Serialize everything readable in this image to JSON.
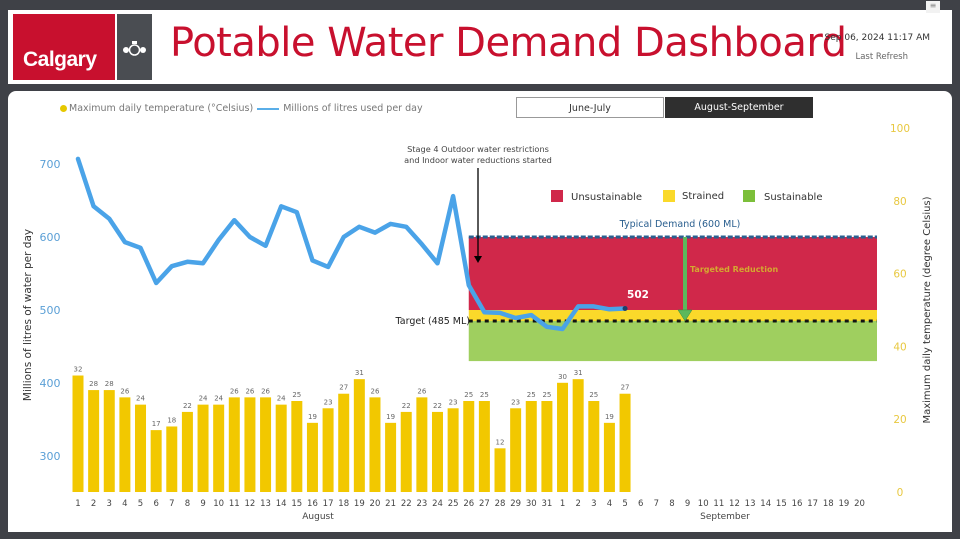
{
  "header": {
    "logo_text": "Calgary",
    "title": "Potable Water Demand Dashboard",
    "refresh_datetime": "Sep 06, 2024 11:17 AM",
    "refresh_label": "Last Refresh",
    "filter_icon": "filter-lines-icon"
  },
  "legend": {
    "temperature_label": "Maximum daily temperature (°Celsius)",
    "usage_label": "Millions of litres used per day"
  },
  "tabs": [
    {
      "label": "June-July",
      "active": false
    },
    {
      "label": "August-September",
      "active": true
    }
  ],
  "colors": {
    "brand_red": "#c8102e",
    "line_blue": "#4aa3e8",
    "bar_yellow": "#f2c800",
    "unsustainable": "#d0284a",
    "strained": "#fad92a",
    "sustainable": "#9fcf5f",
    "typical_demand": "#2a5f8f",
    "arrow_green": "#5cb85c",
    "targeted_text": "#d4a830"
  },
  "chart_data": {
    "type": "bar+line",
    "title": "Potable Water Demand Dashboard",
    "x_groups": [
      {
        "month": "August",
        "days": [
          1,
          2,
          3,
          4,
          5,
          6,
          7,
          8,
          9,
          10,
          11,
          12,
          13,
          14,
          15,
          16,
          17,
          18,
          19,
          20,
          21,
          22,
          23,
          24,
          25,
          26,
          27,
          28,
          29,
          30,
          31
        ]
      },
      {
        "month": "September",
        "days": [
          1,
          2,
          3,
          4,
          5,
          6,
          7,
          8,
          9,
          10,
          11,
          12,
          13,
          14,
          15,
          16,
          17,
          18,
          19,
          20
        ]
      }
    ],
    "ylabel_left": "Millions of litres of water per day",
    "ylabel_right": "Maximum daily temperature (degree Celsius)",
    "y_left_ticks": [
      300,
      400,
      500,
      600,
      700
    ],
    "y_left_range": [
      250,
      750
    ],
    "y_right_ticks": [
      0,
      20,
      40,
      60,
      80,
      100
    ],
    "y_right_range": [
      0,
      100
    ],
    "series": [
      {
        "name": "Millions of litres used per day",
        "type": "line",
        "axis": "left",
        "values": [
          707,
          642,
          625,
          593,
          585,
          537,
          560,
          566,
          564,
          596,
          623,
          600,
          588,
          642,
          634,
          568,
          559,
          600,
          614,
          606,
          618,
          614,
          590,
          564,
          656,
          534,
          497,
          496,
          489,
          493,
          477,
          474,
          505,
          505,
          501,
          502
        ]
      },
      {
        "name": "Maximum daily temperature (°Celsius)",
        "type": "bar",
        "axis": "right",
        "values": [
          32,
          28,
          28,
          26,
          24,
          17,
          18,
          22,
          24,
          24,
          26,
          26,
          26,
          24,
          25,
          19,
          23,
          27,
          31,
          26,
          19,
          22,
          26,
          22,
          23,
          25,
          25,
          12,
          23,
          25,
          25,
          30,
          31,
          25,
          19,
          27
        ]
      }
    ],
    "last_value_label": "502",
    "zones": {
      "start_day_index": 25,
      "end_day_index": 50,
      "legend": [
        "Unsustainable",
        "Strained",
        "Sustainable"
      ],
      "unsustainable": [
        500,
        600
      ],
      "strained": [
        485,
        500
      ],
      "sustainable": [
        430,
        485
      ]
    },
    "reference_lines": {
      "typical_demand": {
        "value": 600,
        "label": "Typical Demand (600 ML)"
      },
      "target": {
        "value": 485,
        "label": "Target (485 ML)"
      }
    },
    "annotations": {
      "stage4": "Stage 4 Outdoor water restrictions and Indoor water reductions started",
      "stage4_line1": "Stage 4 Outdoor water restrictions",
      "stage4_line2": "and Indoor water reductions started",
      "targeted_reduction": "Targeted Reduction"
    }
  }
}
